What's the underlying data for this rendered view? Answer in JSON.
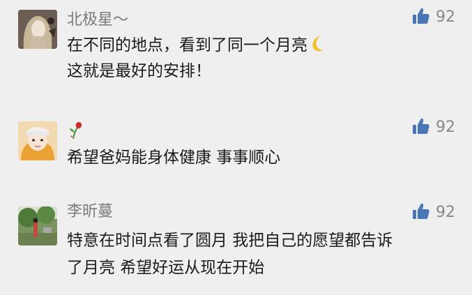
{
  "colors": {
    "background": "#efefef",
    "username": "#7a7a7a",
    "text": "#1b1b1b",
    "like_icon": "#4a76b6",
    "like_count": "#888888"
  },
  "comments": [
    {
      "username": "北极星～",
      "lines": [
        "在不同的地点，看到了同一个月亮",
        "这就是最好的安排！"
      ],
      "emoji": "crescent-moon",
      "likes": "92",
      "avatar": "girl-with-long-hair-photo"
    },
    {
      "username": "",
      "username_icon": "wilted-rose-icon",
      "lines": [
        "希望爸妈能身体健康 事事顺心"
      ],
      "likes": "92",
      "avatar": "girl-with-headband-illustration"
    },
    {
      "username": "李昕蔓",
      "lines": [
        "特意在时间点看了圆月 我把自己的愿望都告诉",
        "了月亮 希望好运从现在开始"
      ],
      "likes": "92",
      "avatar": "outdoor-garden-photo"
    }
  ]
}
